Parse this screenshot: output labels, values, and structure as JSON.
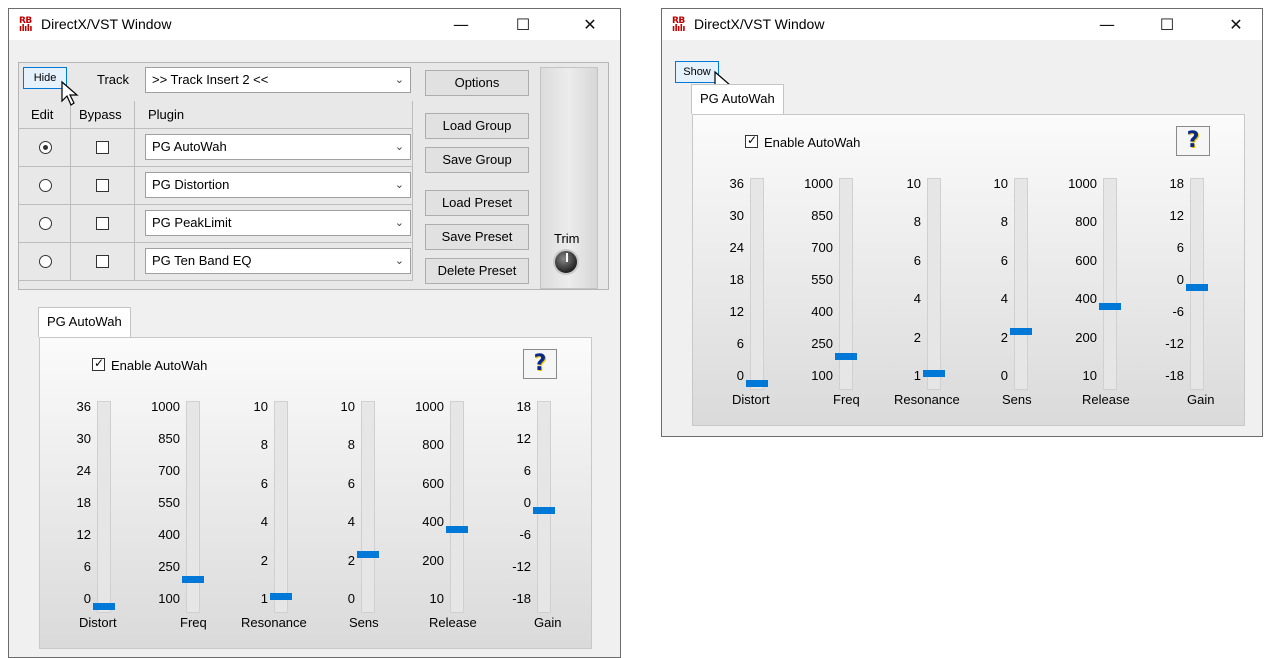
{
  "windows": {
    "left": {
      "title": "DirectX/VST Window",
      "hide_button": "Hide",
      "track_label": "Track",
      "track_value": ">> Track Insert 2 <<",
      "headers": {
        "edit": "Edit",
        "bypass": "Bypass",
        "plugin": "Plugin"
      },
      "rows": [
        {
          "plugin": "PG AutoWah",
          "edit_selected": true
        },
        {
          "plugin": "PG Distortion",
          "edit_selected": false
        },
        {
          "plugin": "PG PeakLimit",
          "edit_selected": false
        },
        {
          "plugin": "PG Ten Band EQ",
          "edit_selected": false
        }
      ],
      "buttons": {
        "options": "Options",
        "load_group": "Load Group",
        "save_group": "Save Group",
        "load_preset": "Load Preset",
        "save_preset": "Save Preset",
        "delete_preset": "Delete Preset"
      },
      "trim_label": "Trim",
      "tab": "PG AutoWah",
      "enable_label": "Enable AutoWah",
      "enable_checked": true
    },
    "right": {
      "title": "DirectX/VST Window",
      "show_button": "Show",
      "tab": "PG AutoWah",
      "enable_label": "Enable AutoWah",
      "enable_checked": true
    }
  },
  "title_buttons": {
    "minimize": "—",
    "maximize": "☐",
    "close": "✕"
  },
  "help_glyph": "?",
  "app_icon": {
    "top": "RB",
    "bottom": "ılılı"
  },
  "sliders": [
    {
      "name": "Distort",
      "ticks": [
        "36",
        "30",
        "24",
        "18",
        "12",
        "6",
        "0"
      ],
      "fraction": 0.0
    },
    {
      "name": "Freq",
      "ticks": [
        "1000",
        "850",
        "700",
        "550",
        "400",
        "250",
        "100"
      ],
      "fraction": 0.14
    },
    {
      "name": "Resonance",
      "ticks": [
        "10",
        "8",
        "6",
        "4",
        "2",
        "1"
      ],
      "fraction": 0.05
    },
    {
      "name": "Sens",
      "ticks": [
        "10",
        "8",
        "6",
        "4",
        "2",
        "0"
      ],
      "fraction": 0.27
    },
    {
      "name": "Release",
      "ticks": [
        "1000",
        "800",
        "600",
        "400",
        "200",
        "10"
      ],
      "fraction": 0.4
    },
    {
      "name": "Gain",
      "ticks": [
        "18",
        "12",
        "6",
        "0",
        "-6",
        "-12",
        "-18"
      ],
      "fraction": 0.5
    }
  ],
  "colors": {
    "accent": "#0078d7",
    "icon_red": "#c00000"
  }
}
